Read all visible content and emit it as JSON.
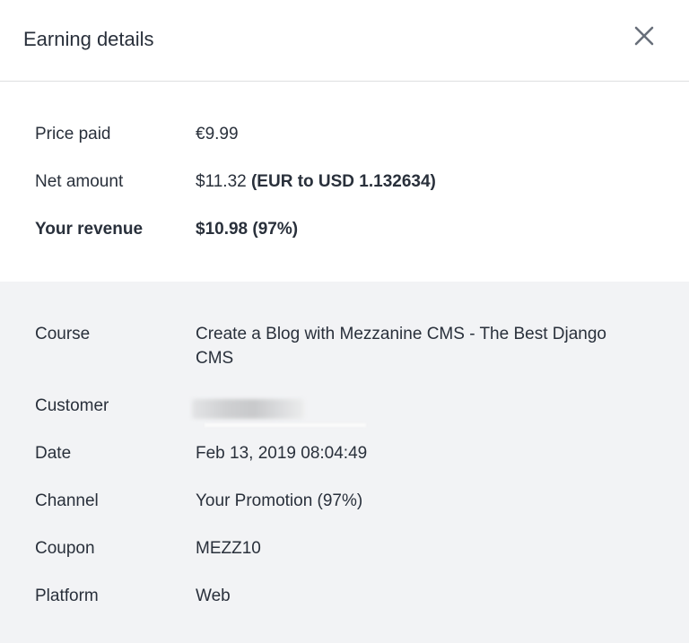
{
  "modal": {
    "title": "Earning details",
    "close_icon": "close-icon"
  },
  "summary": {
    "price_paid": {
      "label": "Price paid",
      "value": "€9.99"
    },
    "net_amount": {
      "label": "Net amount",
      "value": "$11.32",
      "extra": "(EUR to USD 1.132634)"
    },
    "your_revenue": {
      "label": "Your revenue",
      "value": "$10.98 (97%)"
    }
  },
  "details": {
    "course": {
      "label": "Course",
      "value": "Create a Blog with Mezzanine CMS - The Best Django CMS"
    },
    "customer": {
      "label": "Customer"
    },
    "date": {
      "label": "Date",
      "value": "Feb 13, 2019 08:04:49"
    },
    "channel": {
      "label": "Channel",
      "value": "Your Promotion (97%)"
    },
    "coupon": {
      "label": "Coupon",
      "value": "MEZZ10"
    },
    "platform": {
      "label": "Platform",
      "value": "Web"
    }
  },
  "colors": {
    "text": "#29303b",
    "divider": "#dedfe0",
    "details_bg": "#f2f3f5",
    "close_icon": "#686f7a"
  }
}
